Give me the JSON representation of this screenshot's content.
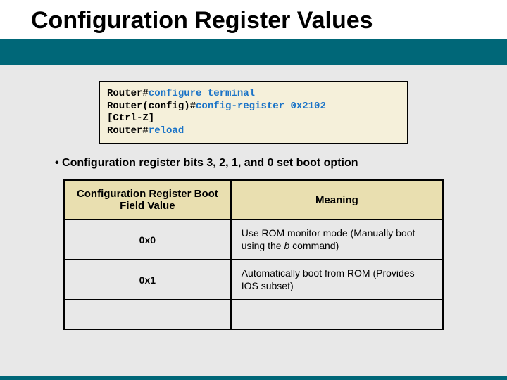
{
  "title": "Configuration Register Values",
  "terminal": {
    "line1_prompt": "Router#",
    "line1_cmd": "configure terminal",
    "line2_prompt": "Router(config)#",
    "line2_cmd": "config-register 0x2102",
    "line3": "[Ctrl-Z]",
    "line4_prompt": "Router#",
    "line4_cmd": "reload"
  },
  "bullet": "Configuration register bits 3, 2, 1, and 0 set boot option",
  "table": {
    "head_col1": "Configuration Register Boot Field Value",
    "head_col2": "Meaning",
    "rows": [
      {
        "value": "0x0",
        "meaning_pre": "Use ROM monitor mode (Manually boot using the ",
        "meaning_em": "b",
        "meaning_post": " command)"
      },
      {
        "value": "0x1",
        "meaning_pre": "Automatically boot from ROM (Provides IOS subset)",
        "meaning_em": "",
        "meaning_post": ""
      }
    ]
  }
}
